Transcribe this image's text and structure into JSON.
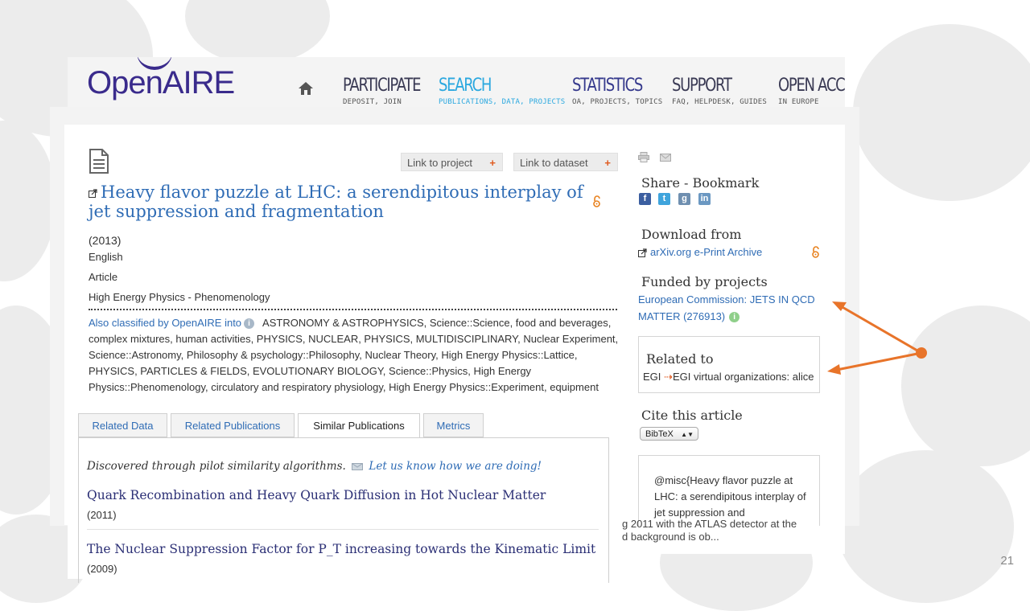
{
  "logo": {
    "text": "OpenAIRE"
  },
  "nav": [
    {
      "title": "PARTICIPATE",
      "sub": "DEPOSIT, JOIN"
    },
    {
      "title": "SEARCH",
      "sub": "PUBLICATIONS, DATA, PROJECTS"
    },
    {
      "title": "STATISTICS",
      "sub": "OA, PROJECTS, TOPICS"
    },
    {
      "title": "SUPPORT",
      "sub": "FAQ, HELPDESK, GUIDES"
    },
    {
      "title": "OPEN ACCES",
      "sub": "IN EUROPE"
    }
  ],
  "actions": {
    "link_project": "Link to project",
    "link_dataset": "Link to dataset",
    "plus": "+"
  },
  "publication": {
    "title": "Heavy flavor puzzle at LHC: a serendipitous interplay of jet suppression and fragmentation",
    "year": "(2013)",
    "language": "English",
    "type": "Article",
    "subject": "High Energy Physics - Phenomenology",
    "classified_label": "Also classified by OpenAIRE into",
    "classified_text": "ASTRONOMY & ASTROPHYSICS, Science::Science, food and beverages, complex mixtures, human activities, PHYSICS, NUCLEAR, PHYSICS, MULTIDISCIPLINARY, Nuclear Experiment, Science::Astronomy, Philosophy & psychology::Philosophy, Nuclear Theory, High Energy Physics::Lattice, PHYSICS, PARTICLES & FIELDS, EVOLUTIONARY BIOLOGY, Science::Physics, High Energy Physics::Phenomenology, circulatory and respiratory physiology, High Energy Physics::Experiment, equipment"
  },
  "tabs": [
    "Related Data",
    "Related Publications",
    "Similar Publications",
    "Metrics"
  ],
  "similar": {
    "intro": "Discovered through pilot similarity algorithms.",
    "feedback": "Let us know how we are doing!",
    "items": [
      {
        "title": "Quark Recombination and Heavy Quark Diffusion in Hot Nuclear Matter",
        "year": "(2011)"
      },
      {
        "title": "The Nuclear Suppression Factor for P_T increasing towards the Kinematic Limit",
        "year": "(2009)"
      }
    ]
  },
  "sidebar": {
    "share_title": "Share - Bookmark",
    "social": [
      "f",
      "t",
      "g",
      "in"
    ],
    "download_title": "Download from",
    "download_link": "arXiv.org e-Print Archive",
    "funded_title": "Funded by projects",
    "funded_line1": "European Commission: JETS IN QCD",
    "funded_line2": "MATTER (276913)",
    "related_title": "Related to",
    "related_prefix": "EGI",
    "related_arrow": "⇢",
    "related_text": "EGI virtual organizations: alice",
    "cite_title": "Cite this article",
    "cite_format": "BibTeX",
    "cite_text": "@misc{Heavy flavor puzzle at LHC: a serendipitous interplay of jet suppression and",
    "overflow_line1": "g 2011 with the ATLAS detector at the",
    "overflow_line2": "d background is ob..."
  },
  "slide_number": "21",
  "colors": {
    "accent": "#2f6cb5",
    "brand": "#3a2b8c",
    "active_nav": "#2ba8df",
    "annotation_arrow": "#e8742a",
    "open_access": "#e8821f"
  }
}
